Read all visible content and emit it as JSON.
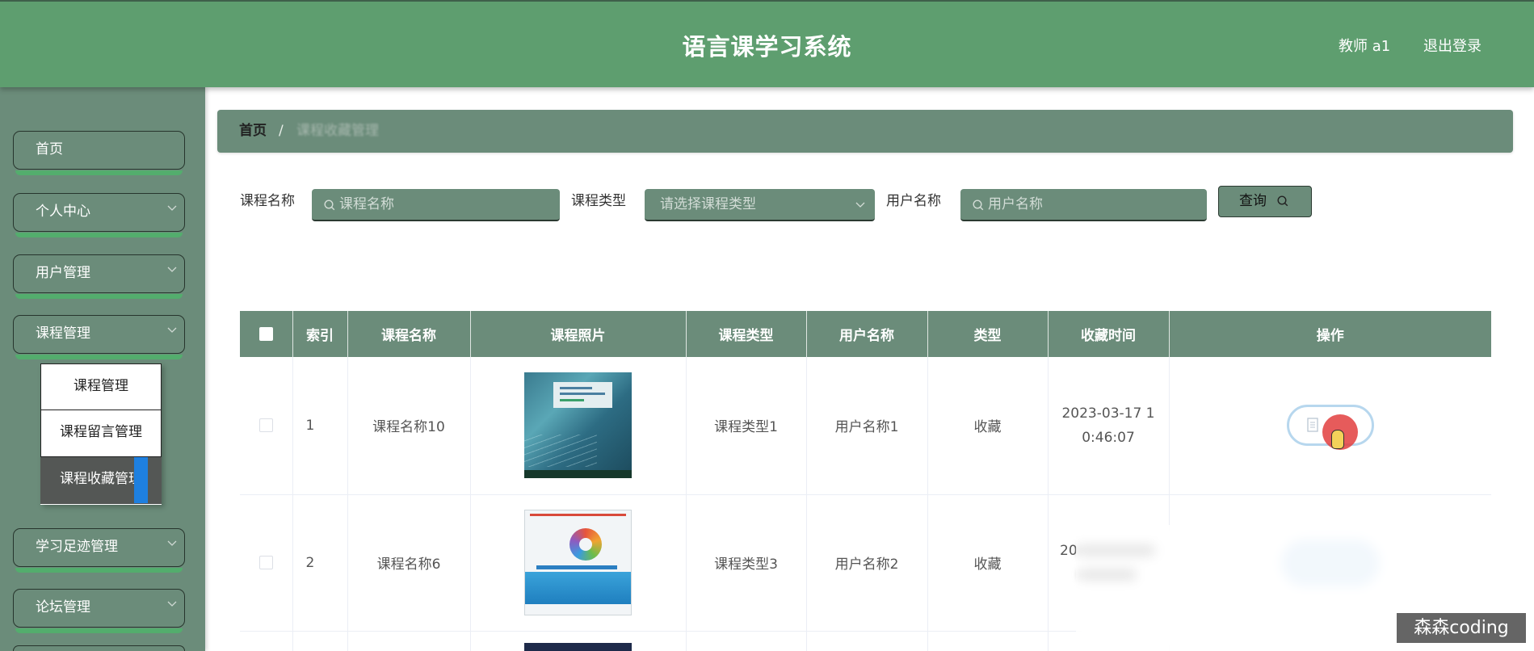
{
  "app": {
    "title": "语言课学习系统",
    "user": "教师 a1",
    "logout": "退出登录"
  },
  "sidebar": {
    "items": [
      {
        "label": "首页",
        "icon": null
      },
      {
        "label": "个人中心",
        "icon": "chevron-down-icon"
      },
      {
        "label": "用户管理",
        "icon": "chevron-down-icon"
      },
      {
        "label": "课程管理",
        "icon": "chevron-down-icon",
        "expanded": true
      },
      {
        "label": "学习足迹管理",
        "icon": "chevron-down-icon"
      },
      {
        "label": "论坛管理",
        "icon": "chevron-down-icon"
      }
    ],
    "submenu": [
      {
        "label": "课程管理",
        "active": false
      },
      {
        "label": "课程留言管理",
        "active": false
      },
      {
        "label": "课程收藏管理",
        "active": true
      }
    ]
  },
  "breadcrumb": {
    "home": "首页",
    "separator": "/",
    "current": "课程收藏管理"
  },
  "search": {
    "course_name_label": "课程名称",
    "course_name_placeholder": "课程名称",
    "course_type_label": "课程类型",
    "course_type_placeholder": "请选择课程类型",
    "user_name_label": "用户名称",
    "user_name_placeholder": "用户名称",
    "query_button": "查询"
  },
  "table": {
    "columns": {
      "index": "索引",
      "course_name": "课程名称",
      "course_photo": "课程照片",
      "course_type": "课程类型",
      "user_name": "用户名称",
      "type": "类型",
      "time": "收藏时间",
      "actions": "操作"
    },
    "rows": [
      {
        "index": "1",
        "course_name": "课程名称10",
        "course_type": "课程类型1",
        "user_name": "用户名称1",
        "type": "收藏",
        "time": "2023-03-17 10:46:07"
      },
      {
        "index": "2",
        "course_name": "课程名称6",
        "course_type": "课程类型3",
        "user_name": "用户名称2",
        "type": "收藏",
        "time": "20"
      }
    ]
  },
  "watermark": "森森coding",
  "colors": {
    "header": "#5e9e6f",
    "panel": "#6b8c7a",
    "menu_underline": "#53ad6d",
    "submenu_active": "#545755",
    "accent_blue": "#1e80e0",
    "action_border": "#b7d7ee"
  }
}
